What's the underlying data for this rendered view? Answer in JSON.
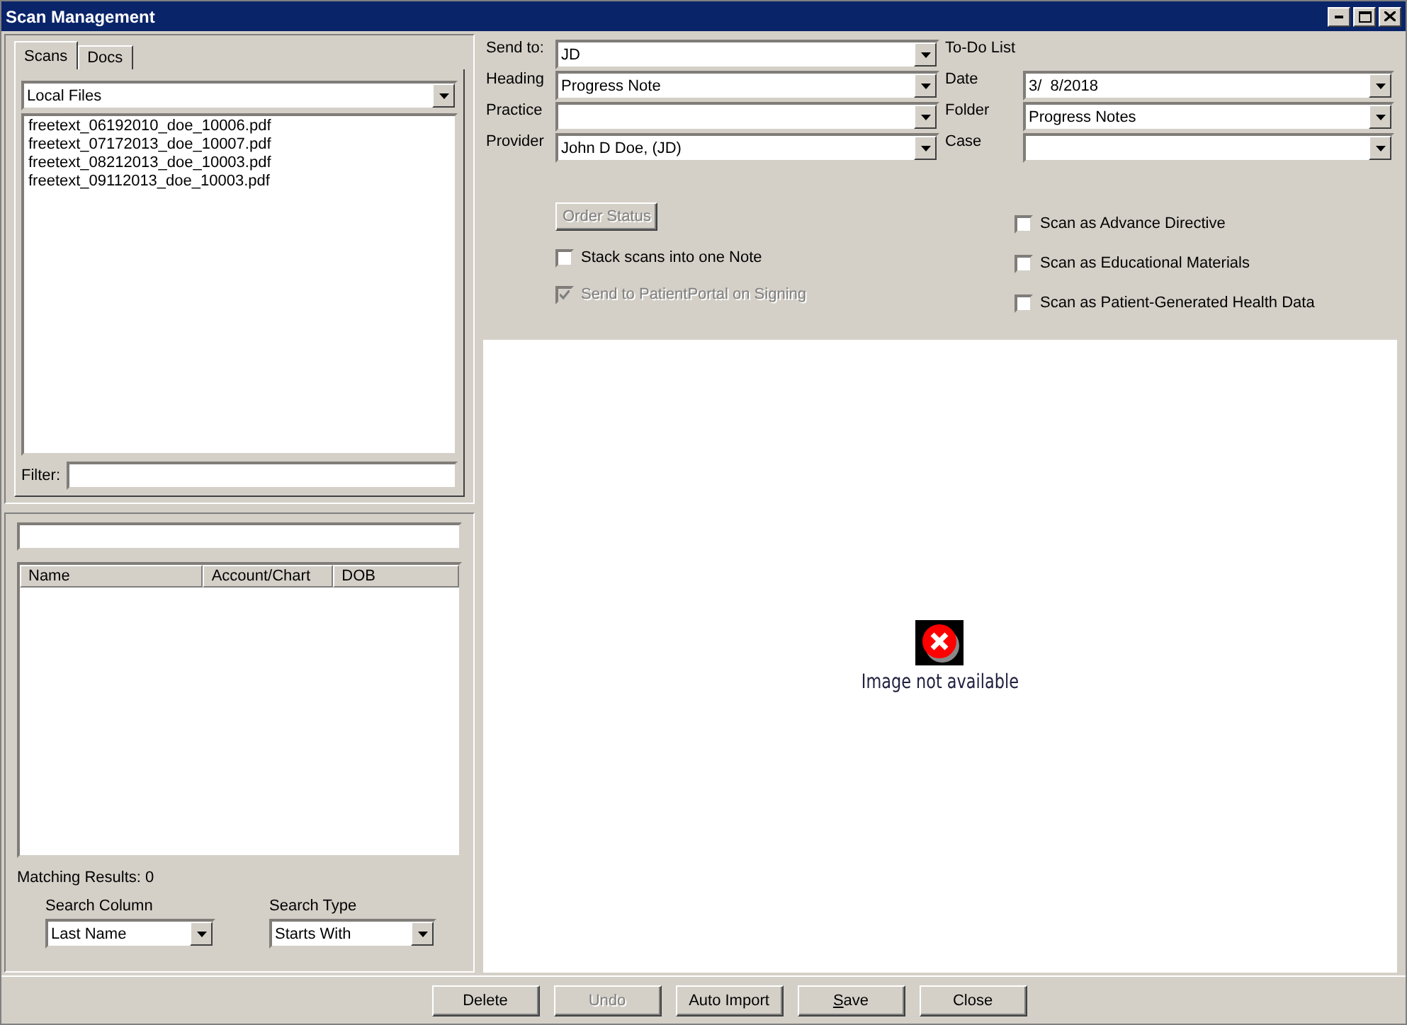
{
  "window": {
    "title": "Scan Management"
  },
  "tabs": [
    {
      "label": "Scans",
      "selected": true
    },
    {
      "label": "Docs",
      "selected": false
    }
  ],
  "source": {
    "value": "Local Files"
  },
  "files": [
    "freetext_06192010_doe_10006.pdf",
    "freetext_07172013_doe_10007.pdf",
    "freetext_08212013_doe_10003.pdf",
    "freetext_09112013_doe_10003.pdf"
  ],
  "filter": {
    "label": "Filter:"
  },
  "patient_table": {
    "columns": [
      "Name",
      "Account/Chart",
      "DOB"
    ]
  },
  "matching_results": "Matching Results: 0",
  "search_column": {
    "label": "Search Column",
    "value": "Last Name"
  },
  "search_type": {
    "label": "Search Type",
    "value": "Starts With"
  },
  "left_fields": [
    {
      "label": "Send to:",
      "value": "JD"
    },
    {
      "label": "Heading",
      "value": "Progress Note"
    },
    {
      "label": "Practice"
    },
    {
      "label": "Provider",
      "value": "John D Doe, (JD)"
    }
  ],
  "todo_label": "To-Do List",
  "right_fields": [
    {
      "label": "Date",
      "value": "3/  8/2018"
    },
    {
      "label": "Folder",
      "value": "Progress Notes"
    },
    {
      "label": "Case"
    }
  ],
  "order_status": {
    "label": "Order Status",
    "disabled": true
  },
  "left_checks": [
    {
      "label": "Stack scans into one Note",
      "checked": false,
      "disabled": false
    },
    {
      "label": "Send to PatientPortal on Signing",
      "checked": true,
      "disabled": true
    }
  ],
  "right_checks": [
    {
      "label": "Scan as Advance Directive",
      "checked": false
    },
    {
      "label": "Scan as Educational Materials",
      "checked": false
    },
    {
      "label": "Scan as Patient-Generated Health Data",
      "checked": false
    }
  ],
  "preview": {
    "message": "Image not available"
  },
  "buttons": [
    {
      "label": "Delete",
      "disabled": false,
      "accelerator": false
    },
    {
      "label": "Undo",
      "disabled": true,
      "accelerator": false
    },
    {
      "label": "Auto Import",
      "disabled": false,
      "accelerator": false
    },
    {
      "label": "Save",
      "disabled": false,
      "accelerator": true
    },
    {
      "label": "Close",
      "disabled": false,
      "accelerator": false
    }
  ]
}
